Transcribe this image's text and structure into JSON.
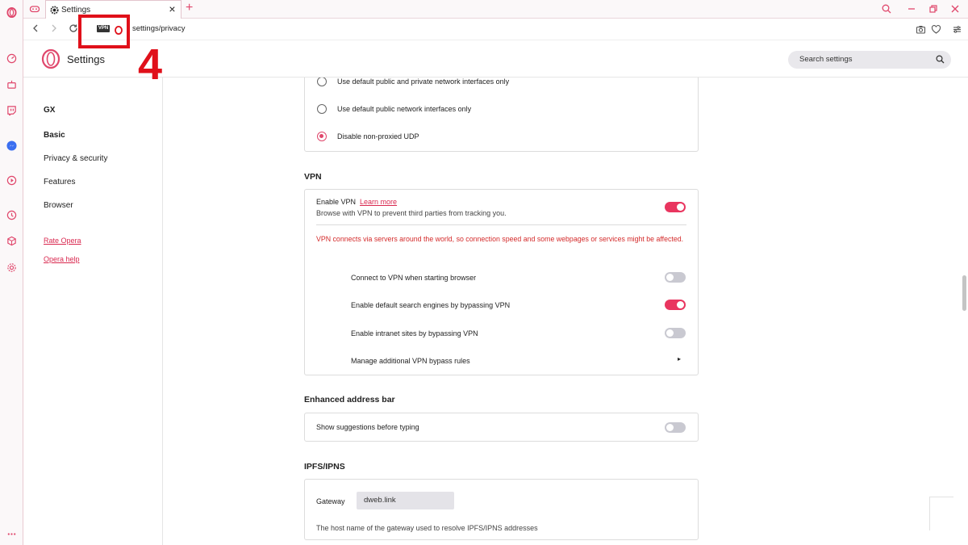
{
  "tab": {
    "title": "Settings"
  },
  "address": {
    "url": "settings/privacy",
    "vpn_badge": "VPN"
  },
  "annotation": {
    "number": "4"
  },
  "header": {
    "title": "Settings",
    "search_placeholder": "Search settings"
  },
  "nav": {
    "items": [
      "GX",
      "Basic",
      "Privacy & security",
      "Features",
      "Browser"
    ],
    "links": [
      "Rate Opera",
      "Opera help"
    ]
  },
  "network": {
    "options": [
      {
        "label": "Use default public and private network interfaces only",
        "checked": false
      },
      {
        "label": "Use default public network interfaces only",
        "checked": false
      },
      {
        "label": "Disable non-proxied UDP",
        "checked": true
      }
    ]
  },
  "vpn": {
    "section_title": "VPN",
    "enable_label": "Enable VPN",
    "learn_more": "Learn more",
    "description": "Browse with VPN to prevent third parties from tracking you.",
    "enabled": true,
    "warning": "VPN connects via servers around the world, so connection speed and some webpages or services might be affected.",
    "options": [
      {
        "label": "Connect to VPN when starting browser",
        "on": false
      },
      {
        "label": "Enable default search engines by bypassing VPN",
        "on": true
      },
      {
        "label": "Enable intranet sites by bypassing VPN",
        "on": false
      }
    ],
    "bypass_rules": "Manage additional VPN bypass rules"
  },
  "address_bar": {
    "section_title": "Enhanced address bar",
    "suggestions_label": "Show suggestions before typing",
    "suggestions_on": false
  },
  "ipfs": {
    "section_title": "IPFS/IPNS",
    "gateway_label": "Gateway",
    "gateway_value": "dweb.link",
    "gateway_help": "The host name of the gateway used to resolve IPFS/IPNS addresses"
  },
  "colors": {
    "accent": "#e0476c",
    "toggle_on": "#e9355f",
    "annotation": "#e0101a"
  }
}
